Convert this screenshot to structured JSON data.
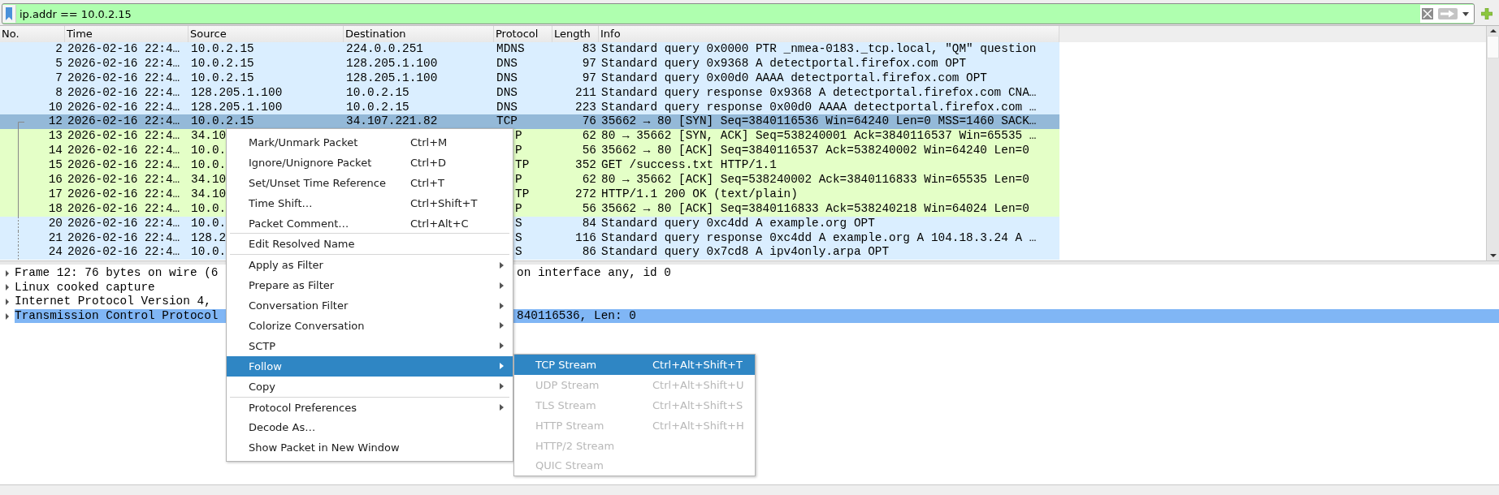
{
  "filter": {
    "value": "ip.addr == 10.0.2.15"
  },
  "columns": [
    "No.",
    "Time",
    "Source",
    "Destination",
    "Protocol",
    "Length",
    "Info"
  ],
  "packets": [
    {
      "no": "2",
      "time": "2026-02-16 22:4…",
      "source": "10.0.2.15",
      "destination": "224.0.0.251",
      "protocol": "MDNS",
      "length": "83",
      "info": "Standard query 0x0000 PTR _nmea-0183._tcp.local, \"QM\" question",
      "color": "#daeeff",
      "selected": false
    },
    {
      "no": "5",
      "time": "2026-02-16 22:4…",
      "source": "10.0.2.15",
      "destination": "128.205.1.100",
      "protocol": "DNS",
      "length": "97",
      "info": "Standard query 0x9368 A detectportal.firefox.com OPT",
      "color": "#daeeff",
      "selected": false
    },
    {
      "no": "7",
      "time": "2026-02-16 22:4…",
      "source": "10.0.2.15",
      "destination": "128.205.1.100",
      "protocol": "DNS",
      "length": "97",
      "info": "Standard query 0x00d0 AAAA detectportal.firefox.com OPT",
      "color": "#daeeff",
      "selected": false
    },
    {
      "no": "8",
      "time": "2026-02-16 22:4…",
      "source": "128.205.1.100",
      "destination": "10.0.2.15",
      "protocol": "DNS",
      "length": "211",
      "info": "Standard query response 0x9368 A detectportal.firefox.com CNA…",
      "color": "#daeeff",
      "selected": false
    },
    {
      "no": "10",
      "time": "2026-02-16 22:4…",
      "source": "128.205.1.100",
      "destination": "10.0.2.15",
      "protocol": "DNS",
      "length": "223",
      "info": "Standard query response 0x00d0 AAAA detectportal.firefox.com …",
      "color": "#daeeff",
      "selected": false
    },
    {
      "no": "12",
      "time": "2026-02-16 22:4…",
      "source": "10.0.2.15",
      "destination": "34.107.221.82",
      "protocol": "TCP",
      "length": "76",
      "info": "35662 → 80 [SYN] Seq=3840116536 Win=64240 Len=0 MSS=1460 SACK…",
      "selected": true,
      "conversation": {
        "kind": "first"
      }
    },
    {
      "no": "13",
      "time": "2026-02-16 22:4…",
      "source": "34.10",
      "protocol": "P",
      "length": "62",
      "info": "80 → 35662 [SYN, ACK] Seq=538240001 Ack=3840116537 Win=65535 …",
      "color": "#e4ffc7",
      "selected": false,
      "obscured": true,
      "conversation": {
        "kind": "member"
      }
    },
    {
      "no": "14",
      "time": "2026-02-16 22:4…",
      "source": "10.0.",
      "protocol": "P",
      "length": "56",
      "info": "35662 → 80 [ACK] Seq=3840116537 Ack=538240002 Win=64240 Len=0",
      "color": "#e4ffc7",
      "selected": false,
      "obscured": true,
      "conversation": {
        "kind": "member"
      }
    },
    {
      "no": "15",
      "time": "2026-02-16 22:4…",
      "source": "10.0.",
      "protocol": "TP",
      "length": "352",
      "info": "GET /success.txt HTTP/1.1",
      "color": "#e4ffc7",
      "selected": false,
      "obscured": true,
      "conversation": {
        "kind": "member"
      }
    },
    {
      "no": "16",
      "time": "2026-02-16 22:4…",
      "source": "34.10",
      "protocol": "P",
      "length": "62",
      "info": "80 → 35662 [ACK] Seq=538240002 Ack=3840116833 Win=65535 Len=0",
      "color": "#e4ffc7",
      "selected": false,
      "obscured": true,
      "conversation": {
        "kind": "member"
      }
    },
    {
      "no": "17",
      "time": "2026-02-16 22:4…",
      "source": "34.10",
      "protocol": "TP",
      "length": "272",
      "info": "HTTP/1.1 200 OK  (text/plain)",
      "color": "#e4ffc7",
      "selected": false,
      "obscured": true,
      "conversation": {
        "kind": "member"
      }
    },
    {
      "no": "18",
      "time": "2026-02-16 22:4…",
      "source": "10.0.",
      "protocol": "P",
      "length": "56",
      "info": "35662 → 80 [ACK] Seq=3840116833 Ack=538240218 Win=64024 Len=0",
      "color": "#e4ffc7",
      "selected": false,
      "obscured": true,
      "conversation": {
        "kind": "member"
      }
    },
    {
      "no": "20",
      "time": "2026-02-16 22:4…",
      "source": "10.0.",
      "protocol": "S",
      "length": "84",
      "info": "Standard query 0xc4dd A example.org OPT",
      "color": "#daeeff",
      "selected": false,
      "obscured": true,
      "conversation": {
        "kind": "related"
      }
    },
    {
      "no": "21",
      "time": "2026-02-16 22:4…",
      "source": "128.2",
      "protocol": "S",
      "length": "116",
      "info": "Standard query response 0xc4dd A example.org A 104.18.3.24 A …",
      "color": "#daeeff",
      "selected": false,
      "obscured": true,
      "conversation": {
        "kind": "related"
      }
    },
    {
      "no": "24",
      "time": "2026-02-16 22:4…",
      "source": "10.0.",
      "protocol": "S",
      "length": "86",
      "info": "Standard query 0x7cd8 A ipv4only.arpa OPT",
      "color": "#daeeff",
      "selected": false,
      "obscured": true,
      "conversation": {
        "kind": "related"
      }
    }
  ],
  "details": [
    {
      "text": "Frame 12: 76 bytes on wire (6",
      "after_menu": "on interface any, id 0",
      "expanded": false,
      "selected": false
    },
    {
      "text": "Linux cooked capture",
      "expanded": false,
      "selected": false
    },
    {
      "text": "Internet Protocol Version 4,",
      "expanded": false,
      "selected": false
    },
    {
      "text": "Transmission Control Protocol",
      "after_menu": "840116536, Len: 0",
      "expanded": false,
      "selected": true
    }
  ],
  "context_menu": {
    "items": [
      {
        "kind": "item",
        "label": "Mark/Unmark Packet",
        "shortcut": "Ctrl+M",
        "submenu": false,
        "selected": false
      },
      {
        "kind": "item",
        "label": "Ignore/Unignore Packet",
        "shortcut": "Ctrl+D",
        "submenu": false,
        "selected": false
      },
      {
        "kind": "item",
        "label": "Set/Unset Time Reference",
        "shortcut": "Ctrl+T",
        "submenu": false,
        "selected": false
      },
      {
        "kind": "item",
        "label": "Time Shift…",
        "shortcut": "Ctrl+Shift+T",
        "submenu": false,
        "selected": false
      },
      {
        "kind": "item",
        "label": "Packet Comment…",
        "shortcut": "Ctrl+Alt+C",
        "submenu": false,
        "selected": false
      },
      {
        "kind": "separator"
      },
      {
        "kind": "item",
        "label": "Edit Resolved Name",
        "submenu": false,
        "selected": false
      },
      {
        "kind": "separator"
      },
      {
        "kind": "item",
        "label": "Apply as Filter",
        "submenu": true,
        "selected": false
      },
      {
        "kind": "item",
        "label": "Prepare as Filter",
        "submenu": true,
        "selected": false
      },
      {
        "kind": "item",
        "label": "Conversation Filter",
        "submenu": true,
        "selected": false
      },
      {
        "kind": "item",
        "label": "Colorize Conversation",
        "submenu": true,
        "selected": false
      },
      {
        "kind": "item",
        "label": "SCTP",
        "submenu": true,
        "selected": false
      },
      {
        "kind": "item",
        "label": "Follow",
        "submenu": true,
        "selected": true
      },
      {
        "kind": "item",
        "label": "Copy",
        "submenu": true,
        "selected": false
      },
      {
        "kind": "separator"
      },
      {
        "kind": "item",
        "label": "Protocol Preferences",
        "submenu": true,
        "selected": false
      },
      {
        "kind": "item",
        "label": "Decode As…",
        "submenu": false,
        "selected": false
      },
      {
        "kind": "item",
        "label": "Show Packet in New Window",
        "submenu": false,
        "selected": false
      }
    ]
  },
  "submenu": {
    "items": [
      {
        "label": "TCP Stream",
        "shortcut": "Ctrl+Alt+Shift+T",
        "disabled": false,
        "selected": true
      },
      {
        "label": "UDP Stream",
        "shortcut": "Ctrl+Alt+Shift+U",
        "disabled": true,
        "selected": false
      },
      {
        "label": "TLS Stream",
        "shortcut": "Ctrl+Alt+Shift+S",
        "disabled": true,
        "selected": false
      },
      {
        "label": "HTTP Stream",
        "shortcut": "Ctrl+Alt+Shift+H",
        "disabled": true,
        "selected": false
      },
      {
        "label": "HTTP/2 Stream",
        "disabled": true,
        "selected": false
      },
      {
        "label": "QUIC Stream",
        "disabled": true,
        "selected": false
      }
    ]
  }
}
